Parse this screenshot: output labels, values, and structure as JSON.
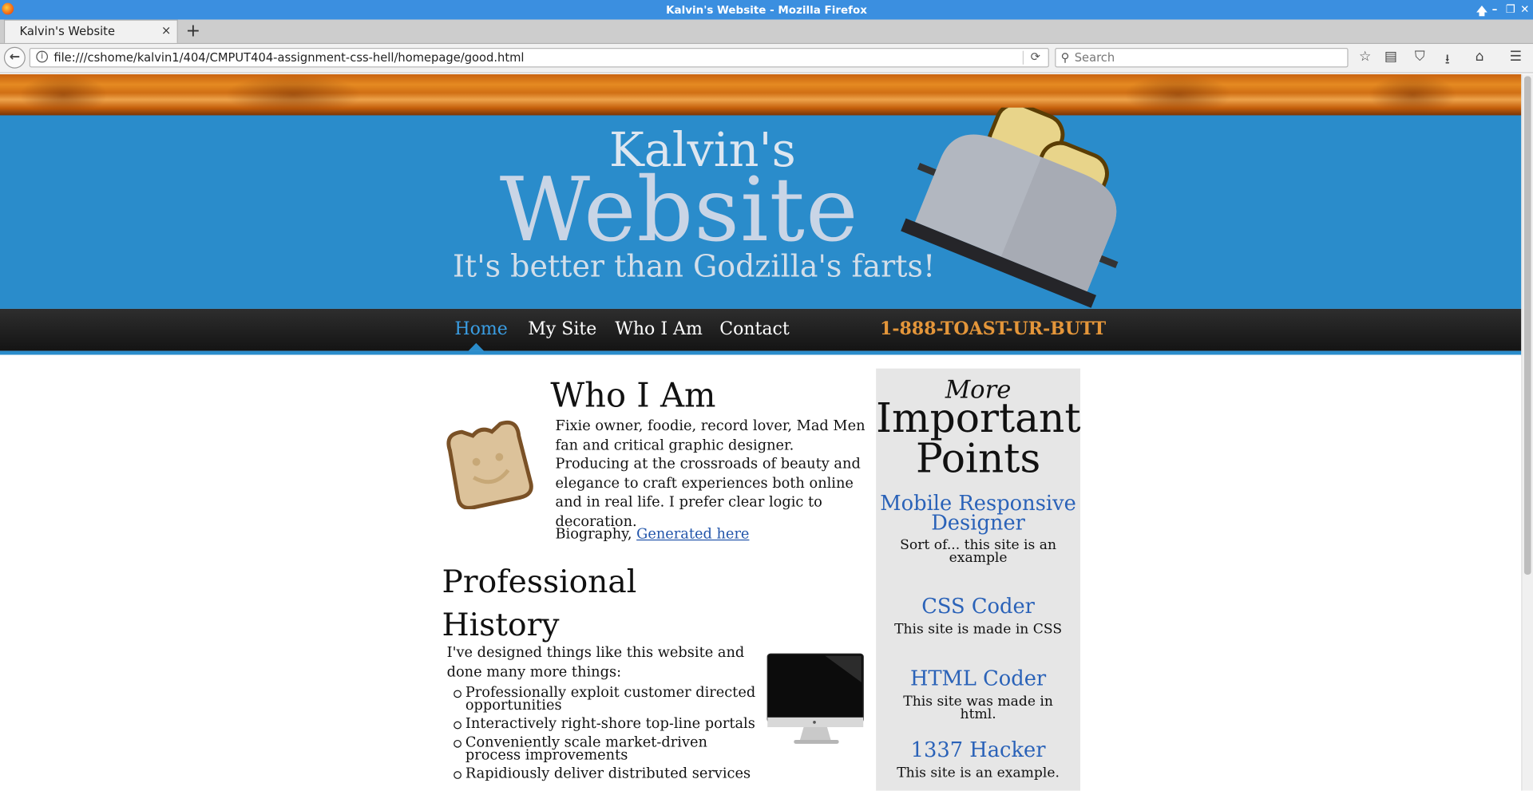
{
  "window": {
    "title": "Kalvin's Website - Mozilla Firefox",
    "controls": [
      "🡅",
      "–",
      "❐",
      "✕"
    ]
  },
  "tab": {
    "label": "Kalvin's Website",
    "close": "×",
    "new": "+"
  },
  "nav": {
    "back": "←",
    "url": "file:///cshome/kalvin1/404/CMPUT404-assignment-css-hell/homepage/good.html",
    "reload": "⟳",
    "search_placeholder": "Search",
    "icons": {
      "bookmark": "☆",
      "library": "▤",
      "pocket": "⛉",
      "download": "⭳",
      "home": "⌂",
      "menu": "☰"
    }
  },
  "hero": {
    "line1": "Kalvin's",
    "line2": "Website",
    "tagline": "It's better than Godzilla's farts!"
  },
  "menu": {
    "items": [
      "Home",
      "My Site",
      "Who I Am",
      "Contact"
    ],
    "phone": "1-888-TOAST-UR-BUTT"
  },
  "who": {
    "heading": "Who I Am",
    "bio": "Fixie owner, foodie, record lover, Mad Men fan and critical graphic designer. Producing at the crossroads of beauty and elegance to craft experiences both online and in real life. I prefer clear logic to decoration.",
    "bio_prefix": "Biography, ",
    "bio_link": "Generated here"
  },
  "professional": {
    "heading": "Professional History",
    "intro": "I've designed things like this website and done many more things:",
    "items": [
      "Professionally exploit customer directed opportunities",
      "Interactively right-shore top-line portals",
      "Conveniently scale market-driven process improvements",
      "Rapidiously deliver distributed services"
    ]
  },
  "aside": {
    "more": "More",
    "heading": "Important Points",
    "points": [
      {
        "title": "Mobile Responsive Designer",
        "desc": "Sort of... this site is an example"
      },
      {
        "title": "CSS Coder",
        "desc": "This site is made in CSS"
      },
      {
        "title": "HTML Coder",
        "desc": "This site was made in html."
      },
      {
        "title": "1337 Hacker",
        "desc": "This site is an example."
      }
    ]
  }
}
